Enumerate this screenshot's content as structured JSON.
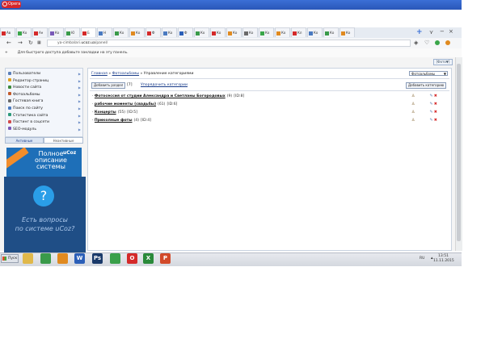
{
  "browser": {
    "name": "Opera",
    "tabs": [
      "Ав",
      "Ко",
      "Ан",
      "Ко",
      "Ю",
      "Б",
      "Н",
      "Ко",
      "Ко",
      "Ф",
      "Ко",
      "Ф",
      "Ко",
      "Ко",
      "Ко",
      "Ко",
      "Ко",
      "Ко",
      "Кл",
      "Ко",
      "Ко",
      "Ко"
    ],
    "new_tab_symbol": "+",
    "url_host": "ya-cimbalari.",
    "url_domain": "ucoz.ua",
    "url_path": "/panel/",
    "bookmarks_hint": "Для быстрого доступа добавьте закладки на эту панель.",
    "bookmarks_plus": "+"
  },
  "panel": {
    "top_selector": "[Фото▼]",
    "sidebar": {
      "items": [
        {
          "label": "Пользователи",
          "icon_color": "#5b7fb8"
        },
        {
          "label": "Редактор страниц",
          "icon_color": "#e0a020"
        },
        {
          "label": "Новости сайта",
          "icon_color": "#3c8a3c"
        },
        {
          "label": "Фотоальбомы",
          "icon_color": "#c25a2a"
        },
        {
          "label": "Гостевая книга",
          "icon_color": "#6a6a6a"
        },
        {
          "label": "Поиск по сайту",
          "icon_color": "#4a7ac0"
        },
        {
          "label": "Статистика сайта",
          "icon_color": "#2c9a7a"
        },
        {
          "label": "Постинг в соцсети",
          "icon_color": "#d24a4a"
        },
        {
          "label": "SEO-модуль",
          "icon_color": "#7a5ab8"
        }
      ],
      "tabs": [
        "Активные",
        "Неактивные"
      ]
    },
    "ads": {
      "ucoz_line1": "Полное",
      "ucoz_line2": "описание",
      "ucoz_line3": "системы",
      "ucoz_brand": "uCoz",
      "help_symbol": "?",
      "help_line1": "Есть вопросы",
      "help_line2": "по системе uCoz?"
    },
    "breadcrumb": {
      "home": "Главная",
      "sep1": "»",
      "albums": "Фотоальбомы",
      "sep2": "»",
      "current": "Управление категориями"
    },
    "module_select": "Фотоальбомы",
    "add_section_button": "Добавить раздел",
    "section_count": "[7]",
    "sort_link": "Упорядочить категории",
    "add_category_button": "Добавить категорию",
    "categories": [
      {
        "name": "Фотосессия от студии Александра и Светланы Богородовых",
        "count": "(9)",
        "id": "[ID:8]"
      },
      {
        "name": "рабочие моменты (свадьбы)",
        "count": "(61)",
        "id": "[ID:6]"
      },
      {
        "name": "Концерты",
        "count": "(55)",
        "id": "[ID:5]"
      },
      {
        "name": "Приколные фоты",
        "count": "(4)",
        "id": "[ID:4]"
      }
    ]
  },
  "taskbar": {
    "start_label": "Пуск",
    "apps": [
      {
        "name": "explorer",
        "glyph": "",
        "color": "#e0b84a"
      },
      {
        "name": "chrome",
        "glyph": "",
        "color": "#3a9a4a"
      },
      {
        "name": "media",
        "glyph": "",
        "color": "#e08a20"
      },
      {
        "name": "word",
        "glyph": "W",
        "color": "#2b5fb8"
      },
      {
        "name": "photoshop",
        "glyph": "Ps",
        "color": "#1a3a6a"
      },
      {
        "name": "app",
        "glyph": "",
        "color": "#3aa04a"
      },
      {
        "name": "opera",
        "glyph": "O",
        "color": "#d42a2a"
      },
      {
        "name": "excel",
        "glyph": "X",
        "color": "#2a8a3a"
      },
      {
        "name": "powerpoint",
        "glyph": "P",
        "color": "#d24a2a"
      }
    ],
    "lang": "RU",
    "time": "13:51",
    "date": "11.11.2015"
  }
}
